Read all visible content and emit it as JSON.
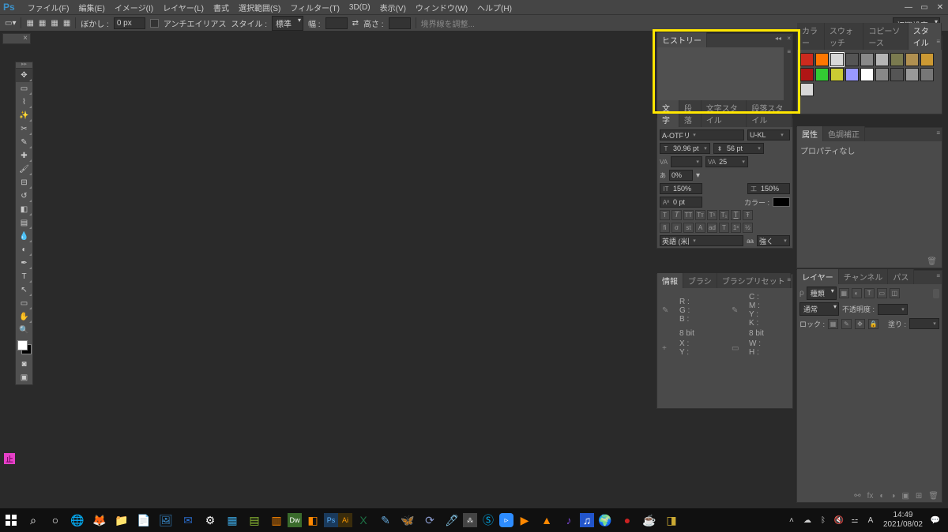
{
  "app_logo": "Ps",
  "menu": {
    "file": "ファイル(F)",
    "edit": "編集(E)",
    "image": "イメージ(I)",
    "layer": "レイヤー(L)",
    "type": "書式",
    "select": "選択範囲(S)",
    "filter": "フィルター(T)",
    "3d": "3D(D)",
    "view": "表示(V)",
    "window": "ウィンドウ(W)",
    "help": "ヘルプ(H)"
  },
  "workspace_selector": "初期設定",
  "options": {
    "feather_label": "ぼかし :",
    "feather_value": "0 px",
    "antialias": "アンチエイリアス",
    "style_label": "スタイル :",
    "style_value": "標準",
    "width_label": "幅 :",
    "height_label": "高さ :",
    "refine": "境界線を調整..."
  },
  "history": {
    "tab": "ヒストリー"
  },
  "colors": {
    "tab_color": "カラー",
    "tab_swatch": "スウォッチ",
    "tab_cssource": "コピーソース",
    "tab_style": "スタイル",
    "swatches_row1": [
      "#cc2a1e",
      "#ff7700",
      "#d8d8d8",
      "#555555",
      "#888888",
      "#b5b5b5",
      "#7a7a4f",
      "#b09050",
      "#cc9933"
    ],
    "swatches_row2": [
      "#b01515",
      "#33cc33",
      "#cccc33",
      "#9999ff",
      "#ffffff",
      "#888888",
      "#555555",
      "#999999",
      "#777777"
    ],
    "swatches_row3": [
      "#d8d8d8"
    ]
  },
  "character": {
    "tab_char": "文字",
    "tab_para": "段落",
    "tab_cstyle": "文字スタイル",
    "tab_pstyle": "段落スタイル",
    "font": "A-OTFリュウ...",
    "weight": "U-KL",
    "size": "30.96 pt",
    "leading": "56 pt",
    "va1": "VA",
    "va_metric": "25",
    "scale_lbl": "あ",
    "scale_val": "0%",
    "h_scale": "150%",
    "v_scale": "150%",
    "baseline": "0 pt",
    "color_lbl": "カラー :",
    "lang": "英語 (米国)",
    "aa_lbl": "aa",
    "aa": "強く"
  },
  "info": {
    "tab_info": "情報",
    "tab_brush": "ブラシ",
    "tab_preset": "ブラシプリセット",
    "r": "R :",
    "g": "G :",
    "b": "B :",
    "c": "C :",
    "m": "M :",
    "y": "Y :",
    "k": "K :",
    "bit1": "8 bit",
    "bit2": "8 bit",
    "x": "X :",
    "y2": "Y :",
    "w": "W :",
    "h": "H :"
  },
  "properties": {
    "tab_props": "属性",
    "tab_maskadj": "色調補正",
    "none": "プロパティなし"
  },
  "layers": {
    "tab_layer": "レイヤー",
    "tab_channel": "チャンネル",
    "tab_path": "パス",
    "filter": "種類",
    "blend": "通常",
    "opacity_lbl": "不透明度 :",
    "lock": "ロック :",
    "fill_lbl": "塗り :"
  },
  "taskbar": {
    "time": "14:49",
    "date": "2021/08/02"
  }
}
